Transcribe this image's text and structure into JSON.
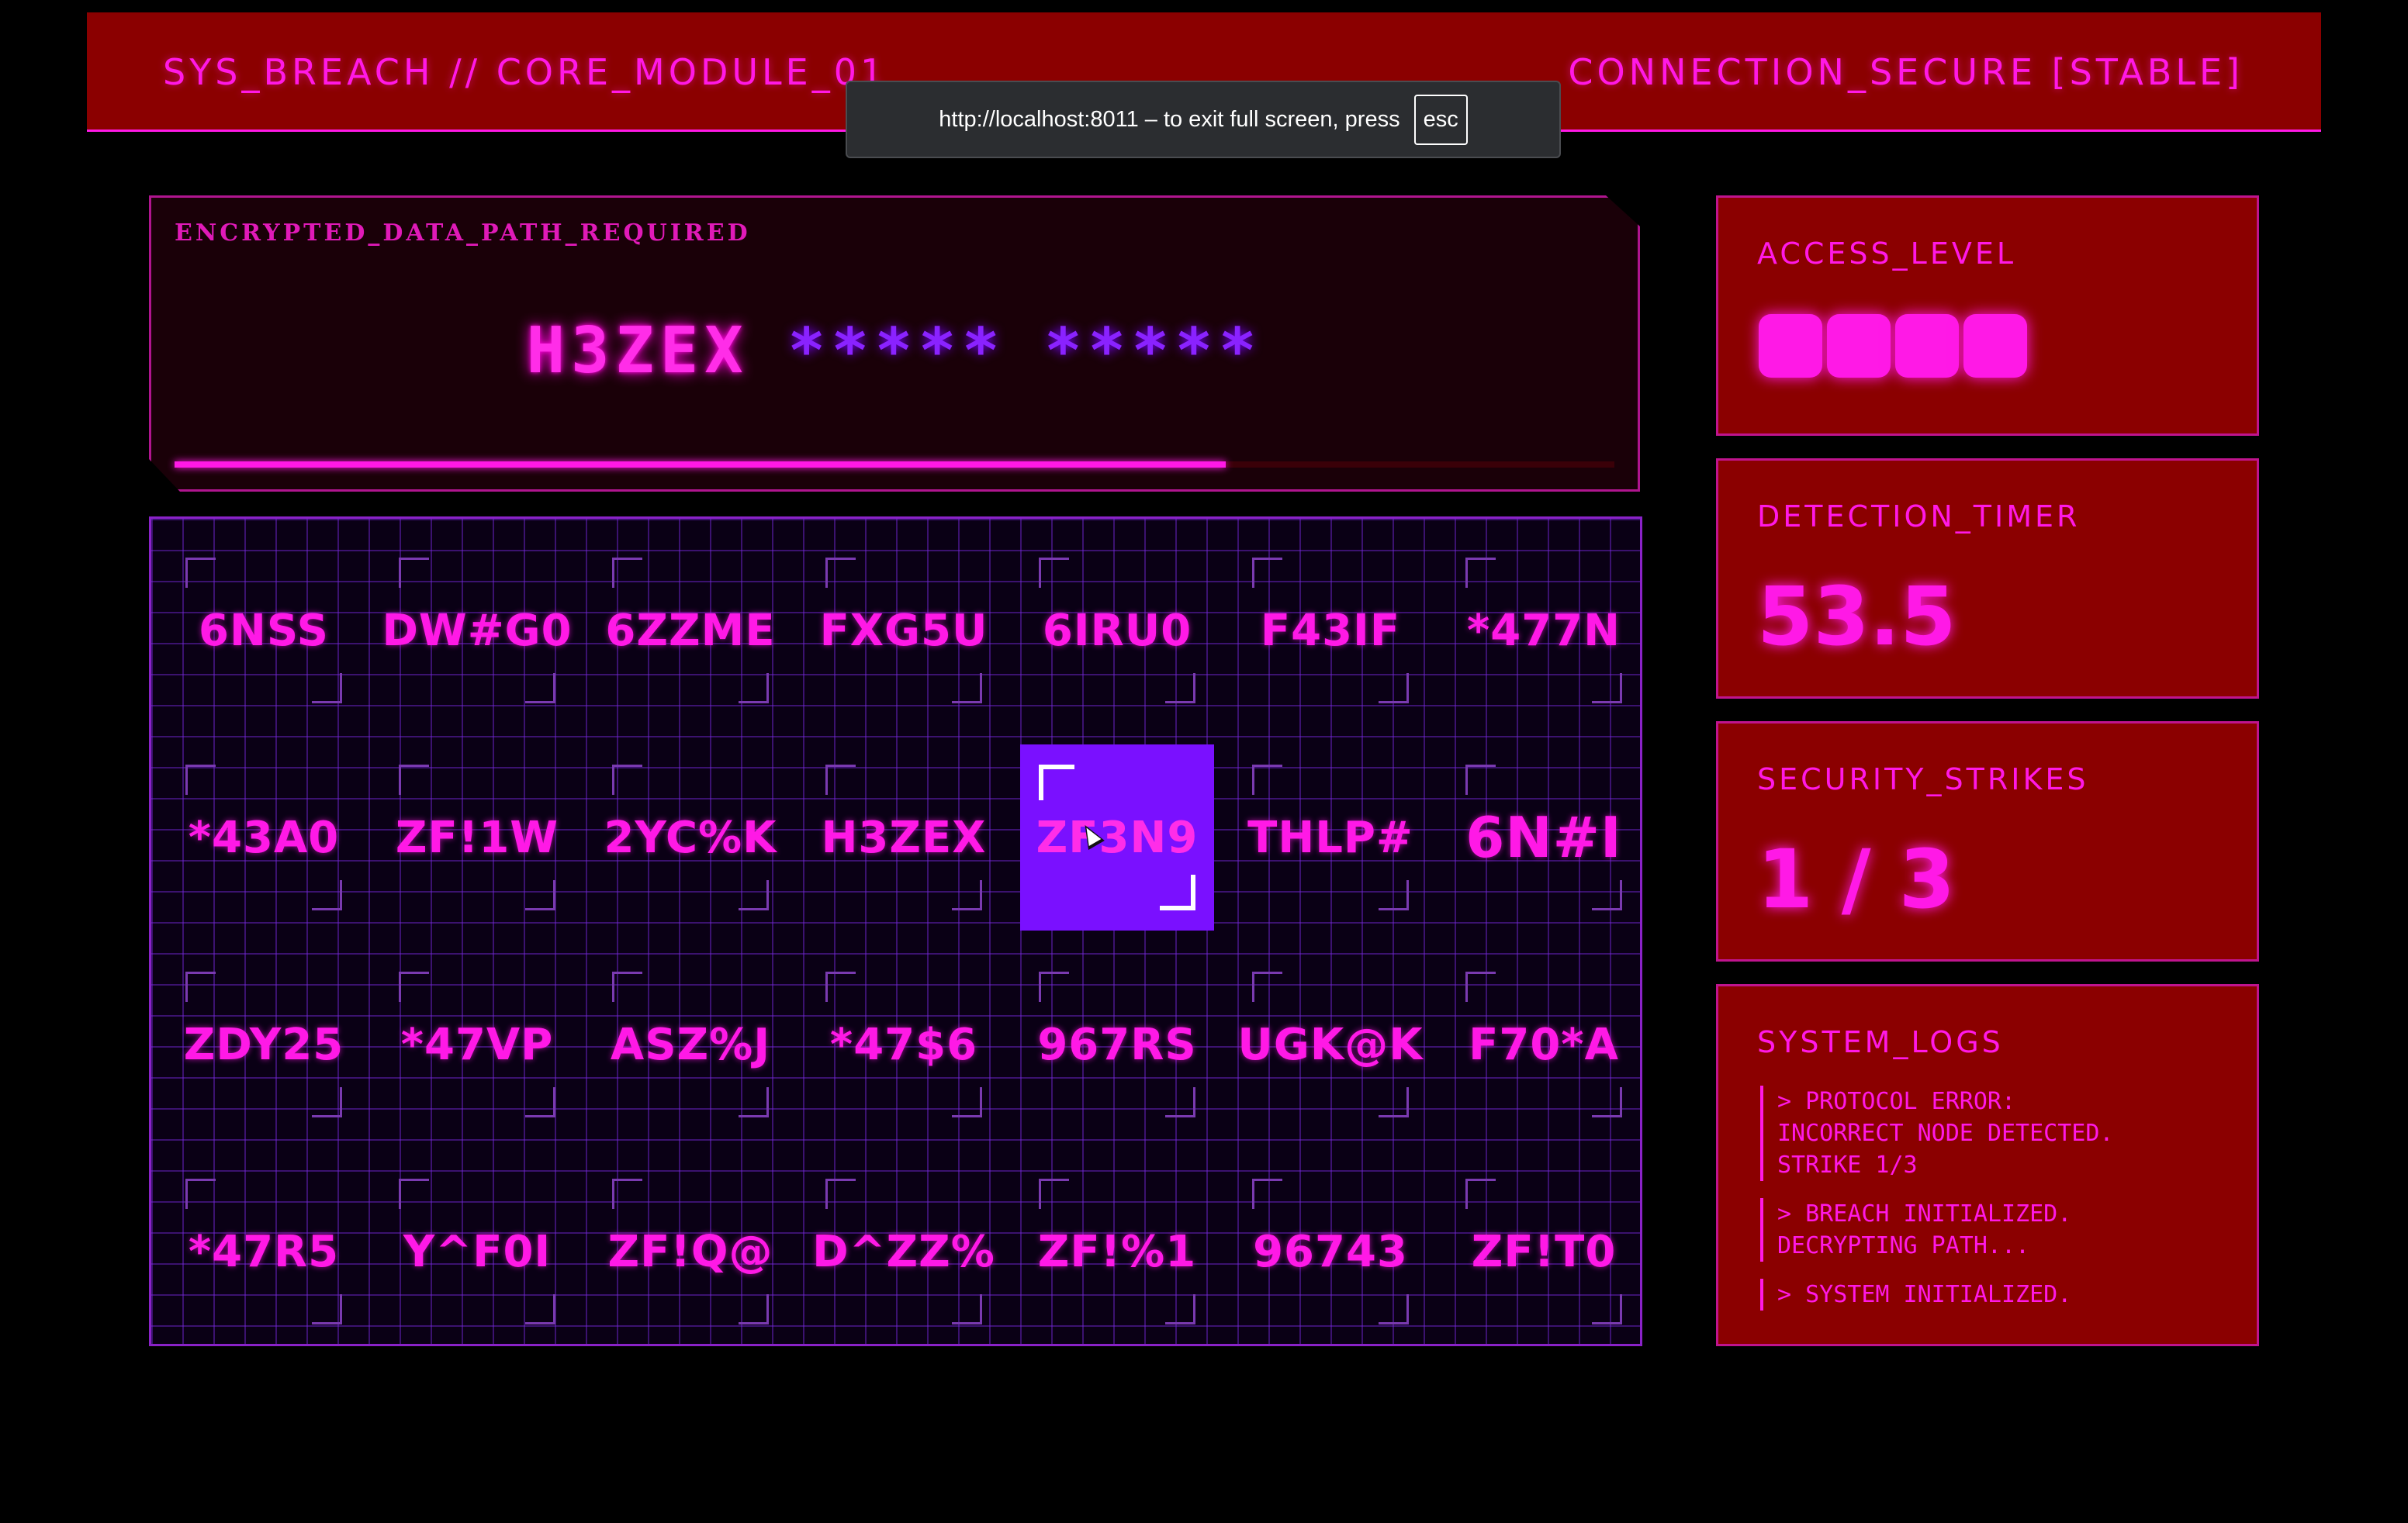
{
  "header": {
    "left_title": "SYS_BREACH // CORE_MODULE_01",
    "right_status": "CONNECTION_SECURE [STABLE]"
  },
  "fullscreen_notice": {
    "text": "http://localhost:8011 – to exit full screen, press",
    "key": "esc"
  },
  "decryption": {
    "label": "ENCRYPTED_DATA_PATH_REQUIRED",
    "found_segment": "H3ZEX",
    "hidden_segments": [
      "*****",
      "*****"
    ],
    "progress": 0.73
  },
  "grid": {
    "rows": [
      [
        "6NSS",
        "DW#G0",
        "6ZZME",
        "FXG5U",
        "6IRU0",
        "F43IF",
        "*477N"
      ],
      [
        "*43A0",
        "ZF!1W",
        "2YC%K",
        "H3ZEX",
        "ZF3N9",
        "THLP#",
        "6N#I"
      ],
      [
        "ZDY25",
        "*47VP",
        "ASZ%J",
        "*47$6",
        "967RS",
        "UGK@K",
        "F70*A"
      ],
      [
        "*47R5",
        "Y^F0I",
        "ZF!Q@",
        "D^ZZ%",
        "ZF!%1",
        "96743",
        "ZF!T0"
      ]
    ],
    "active_row": 1,
    "active_col": 4
  },
  "cards": {
    "access_level": {
      "title": "ACCESS_LEVEL",
      "blocks": 4
    },
    "detection_timer": {
      "title": "DETECTION_TIMER",
      "value": "53.5"
    },
    "security_strikes": {
      "title": "SECURITY_STRIKES",
      "value": "1 / 3"
    },
    "system_logs": {
      "title": "SYSTEM_LOGS",
      "entries": [
        "> PROTOCOL ERROR:\nINCORRECT NODE DETECTED.\nSTRIKE 1/3",
        "> BREACH INITIALIZED.\nDECRYPTING PATH...",
        "> SYSTEM INITIALIZED."
      ]
    }
  },
  "colors": {
    "accent": "#ff19e6",
    "panel_red": "#8b0000",
    "active_node": "#7a10ff",
    "hidden_path": "#8a22ff"
  }
}
